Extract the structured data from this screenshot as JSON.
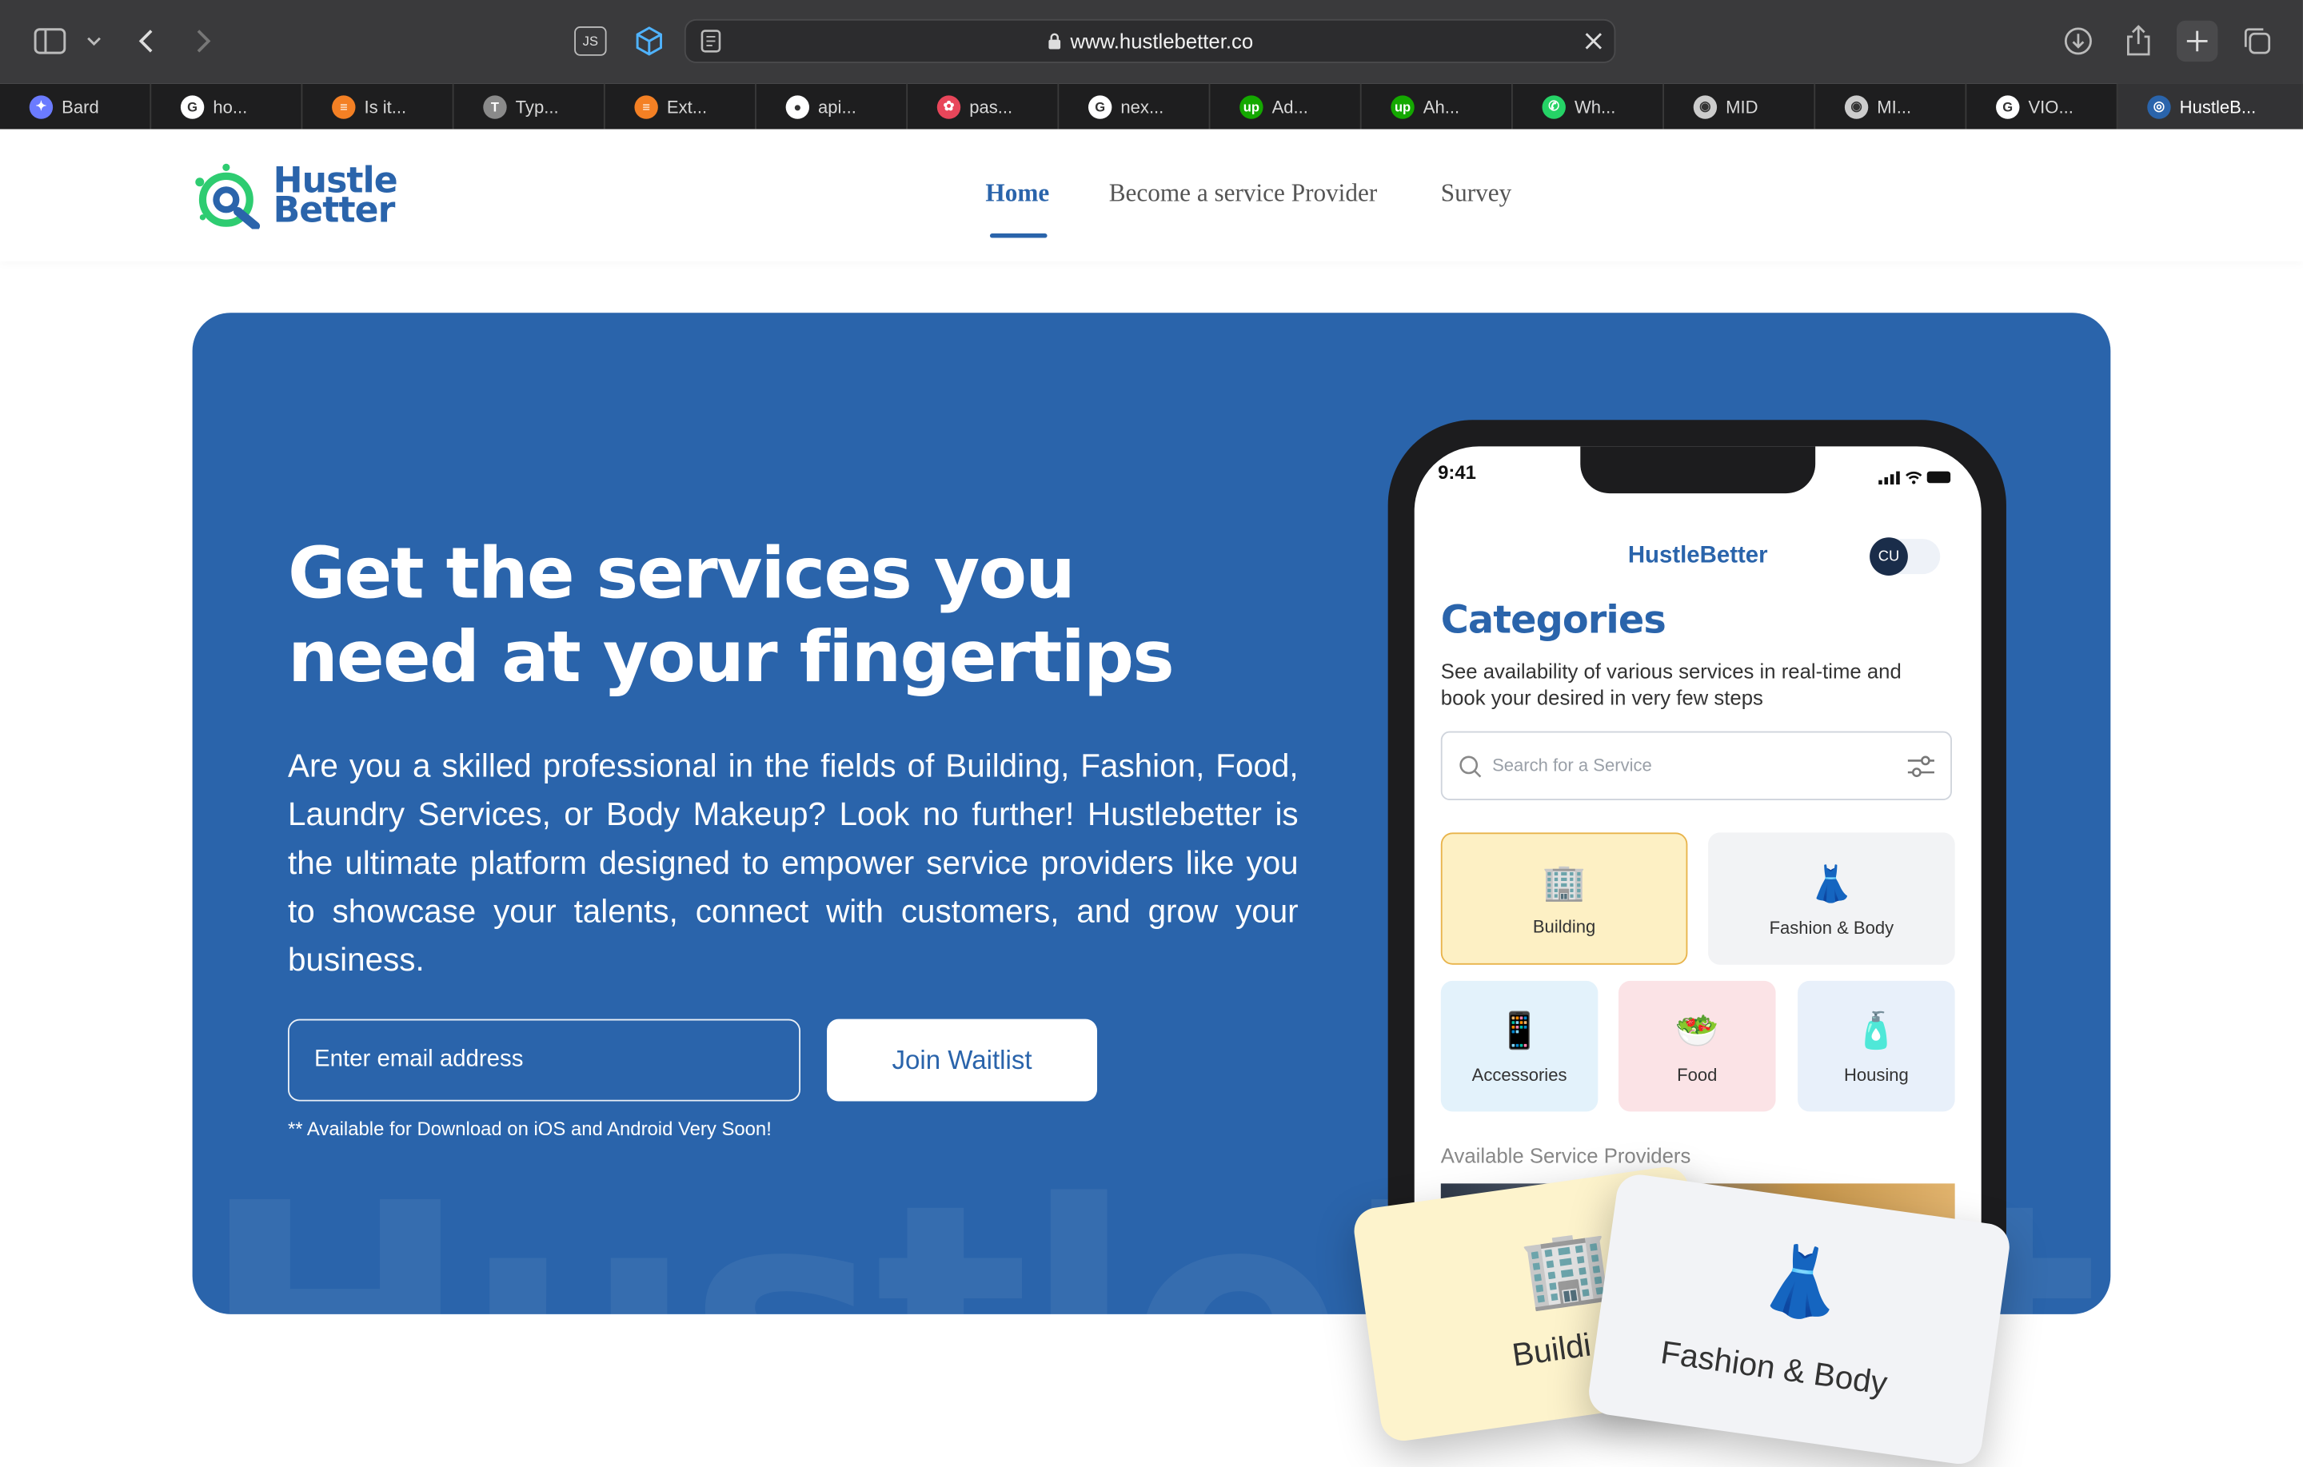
{
  "browser": {
    "url": "www.hustlebetter.co",
    "js_badge": "JS",
    "tabs": [
      {
        "label": "Bard",
        "favicon_color": "#6b7bff",
        "favicon_glyph": "✦"
      },
      {
        "label": "ho...",
        "favicon_color": "#ffffff",
        "favicon_glyph": "G"
      },
      {
        "label": "Is it...",
        "favicon_color": "#f48024",
        "favicon_glyph": "≡"
      },
      {
        "label": "Typ...",
        "favicon_color": "#8a8a8a",
        "favicon_glyph": "T"
      },
      {
        "label": "Ext...",
        "favicon_color": "#f48024",
        "favicon_glyph": "≡"
      },
      {
        "label": "api...",
        "favicon_color": "#ffffff",
        "favicon_glyph": "●"
      },
      {
        "label": "pas...",
        "favicon_color": "#e8465a",
        "favicon_glyph": "✿"
      },
      {
        "label": "nex...",
        "favicon_color": "#ffffff",
        "favicon_glyph": "G"
      },
      {
        "label": "Ad...",
        "favicon_color": "#14a800",
        "favicon_glyph": "up"
      },
      {
        "label": "Ah...",
        "favicon_color": "#14a800",
        "favicon_glyph": "up"
      },
      {
        "label": "Wh...",
        "favicon_color": "#25d366",
        "favicon_glyph": "✆"
      },
      {
        "label": "MID",
        "favicon_color": "#cccccc",
        "favicon_glyph": "◉"
      },
      {
        "label": "MI...",
        "favicon_color": "#cccccc",
        "favicon_glyph": "◉"
      },
      {
        "label": "VIO...",
        "favicon_color": "#ffffff",
        "favicon_glyph": "G"
      },
      {
        "label": "HustleB...",
        "favicon_color": "#2a64ab",
        "favicon_glyph": "◎"
      }
    ]
  },
  "site": {
    "logo_line1": "Hustle",
    "logo_line2": "Better",
    "nav": [
      {
        "label": "Home",
        "active": true
      },
      {
        "label": "Become a service Provider",
        "active": false
      },
      {
        "label": "Survey",
        "active": false
      }
    ]
  },
  "hero": {
    "title_line1": "Get the services you",
    "title_line2": "need at your fingertips",
    "description": "Are you a skilled professional in the fields of Building, Fashion, Food, Laundry Services, or Body Makeup? Look no further! Hustlebetter is the ultimate platform designed to empower service providers like you to showcase your talents, connect with customers, and grow your business.",
    "email_placeholder": "Enter email address",
    "join_button": "Join Waitlist",
    "note": "** Available for Download on iOS and Android Very Soon!",
    "watermark": "HustleBetter"
  },
  "phone": {
    "time": "9:41",
    "brand": "HustleBetter",
    "avatar": "CU",
    "title": "Categories",
    "subtitle": "See availability of various services in real-time and book your desired in very few steps",
    "search_placeholder": "Search for a Service",
    "categories": [
      {
        "label": "Building",
        "icon": "🏢",
        "bg": "#fdf0c4"
      },
      {
        "label": "Fashion & Body",
        "icon": "👗",
        "bg": "#f2f3f5"
      },
      {
        "label": "Accessories",
        "icon": "📱",
        "bg": "#e3f2fb"
      },
      {
        "label": "Food",
        "icon": "🥗",
        "bg": "#fbe3e6"
      },
      {
        "label": "Housing",
        "icon": "🧴",
        "bg": "#e8f0fa"
      }
    ],
    "providers_heading": "Available Service Providers"
  },
  "floating_cards": [
    {
      "label": "Buildi",
      "icon": "🏢"
    },
    {
      "label": "Fashion & Body",
      "icon": "👗"
    }
  ],
  "colors": {
    "brand": "#2a64ab",
    "accent_green": "#2ecc71"
  }
}
